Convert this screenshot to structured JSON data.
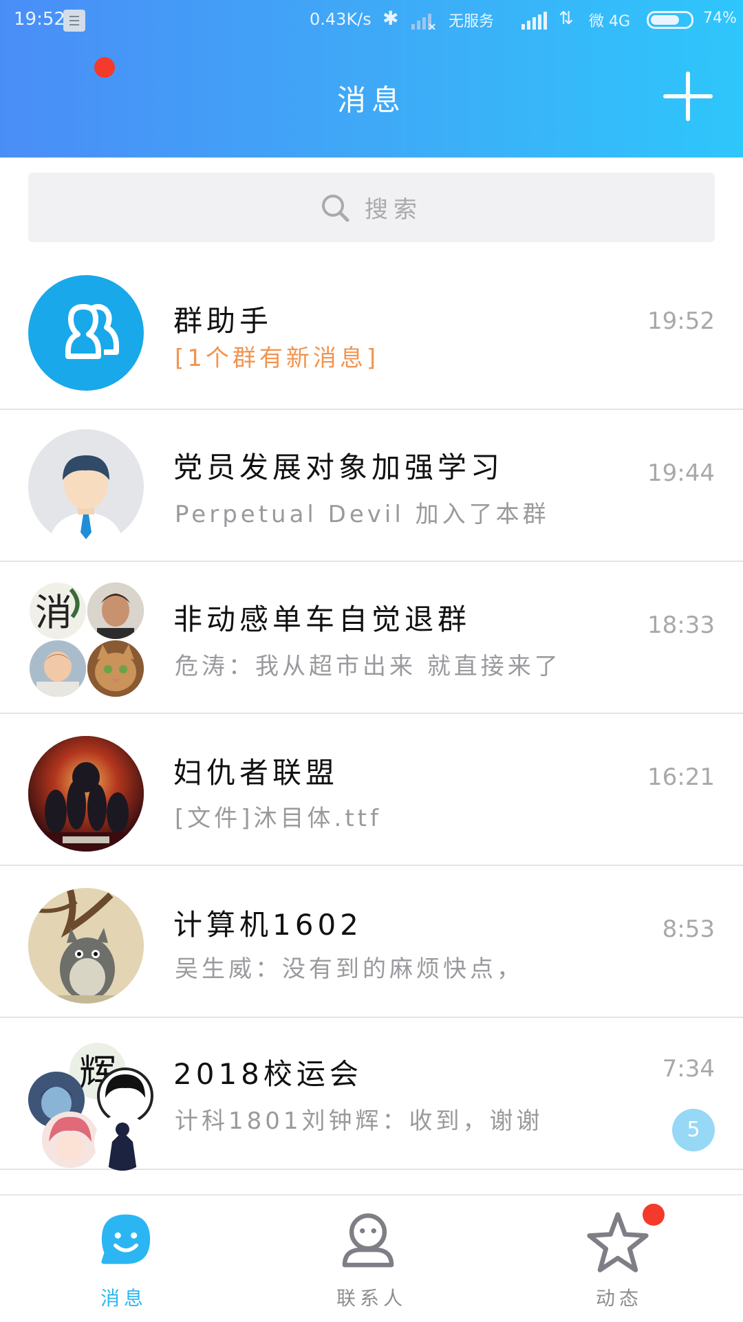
{
  "status_bar": {
    "time": "19:52",
    "speed": "0.43K/s",
    "no_service": "无服务",
    "network": "微 4G",
    "battery": "74%",
    "battery_level": 0.74
  },
  "header": {
    "title": "消息"
  },
  "search": {
    "placeholder": "搜索"
  },
  "conversations": [
    {
      "name": "群助手",
      "preview": "[1个群有新消息]",
      "time": "19:52",
      "avatar": "group-helper-icon"
    },
    {
      "name": "党员发展对象加强学习",
      "preview": "Perpetual Devil 加入了本群",
      "time": "19:44",
      "avatar": "default-person-avatar"
    },
    {
      "name": "非动感单车自觉退群",
      "preview": "危涛：我从超市出来 就直接来了",
      "time": "18:33",
      "avatar": "group-collage-avatar"
    },
    {
      "name": "妇仇者联盟",
      "preview": "[文件]沐目体.ttf",
      "time": "16:21",
      "avatar": "movie-poster-avatar"
    },
    {
      "name": "计算机1602",
      "preview": "吴生威：没有到的麻烦快点，",
      "time": "8:53",
      "avatar": "totoro-avatar"
    },
    {
      "name": "2018校运会",
      "preview": "计科1801刘钟辉：收到，谢谢",
      "time": "7:34",
      "avatar": "group-collage-avatar",
      "badge": "5"
    }
  ],
  "bottom_nav": {
    "tabs": [
      {
        "label": "消息",
        "icon": "message-face-icon",
        "active": true
      },
      {
        "label": "联系人",
        "icon": "contacts-person-icon",
        "active": false
      },
      {
        "label": "动态",
        "icon": "star-icon",
        "active": false
      }
    ]
  },
  "colors": {
    "header_start": "#4a8df7",
    "header_end": "#2ec6fb",
    "accent": "#2bb5f2",
    "unread_dot": "#f43a2a",
    "badge": "#96d8f6",
    "highlight_preview": "#f29450"
  }
}
